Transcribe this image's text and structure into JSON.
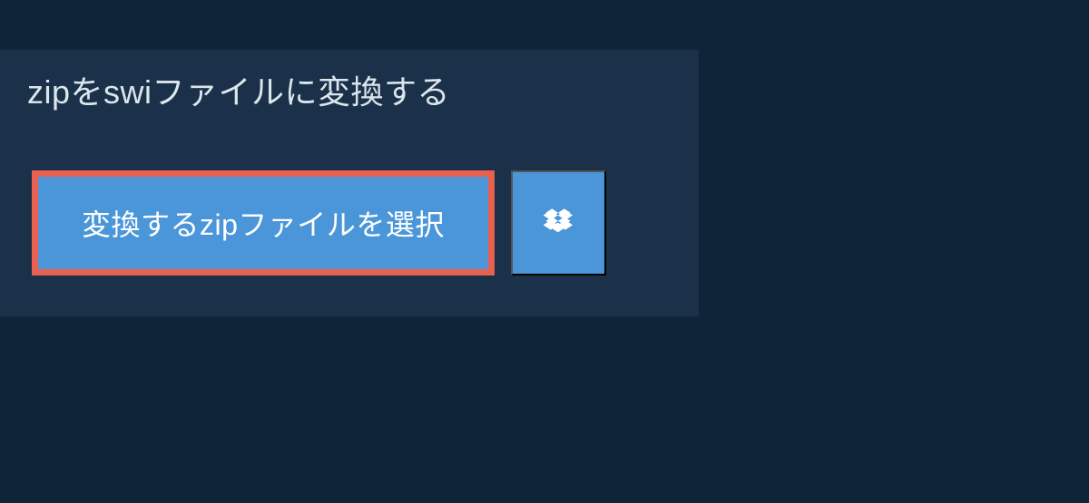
{
  "heading": "zipをswiファイルに変換する",
  "selectButton": {
    "label": "変換するzipファイルを選択"
  },
  "colors": {
    "background": "#0f2438",
    "panel": "#1a3149",
    "buttonBg": "#4a96d9",
    "buttonBorder": "#e8604f",
    "textLight": "#dce6ed",
    "textWhite": "#ffffff"
  }
}
